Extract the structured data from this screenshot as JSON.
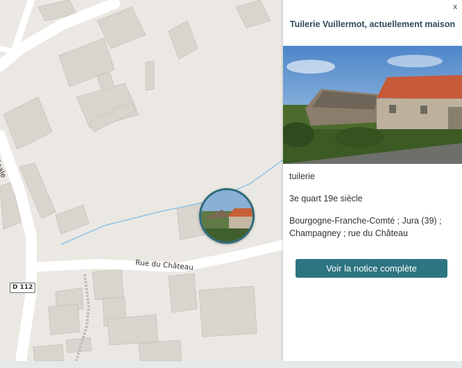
{
  "map": {
    "roads": [
      {
        "name": "Rue du Château",
        "label": "Rue du Château"
      },
      {
        "name": "partial-road-label",
        "label": "ipale"
      }
    ],
    "route_shield": "D 112",
    "marker": {
      "name": "photo-marker-tuilerie"
    }
  },
  "panel": {
    "close_label": "x",
    "title": "Tuilerie Vuillermot, actuellement maison",
    "type": "tuilerie",
    "date": "3e quart 19e siècle",
    "location": "Bourgogne-Franche-Comté ; Jura (39) ; Champagney ; rue du Château",
    "button_label": "Voir la notice complète"
  },
  "colors": {
    "accent": "#2e7582",
    "title": "#2e4b57",
    "marker_border": "#2e6b7a",
    "map_background": "#ebe8e3",
    "building": "#d9d4ce",
    "stream": "#8ec3e8"
  }
}
